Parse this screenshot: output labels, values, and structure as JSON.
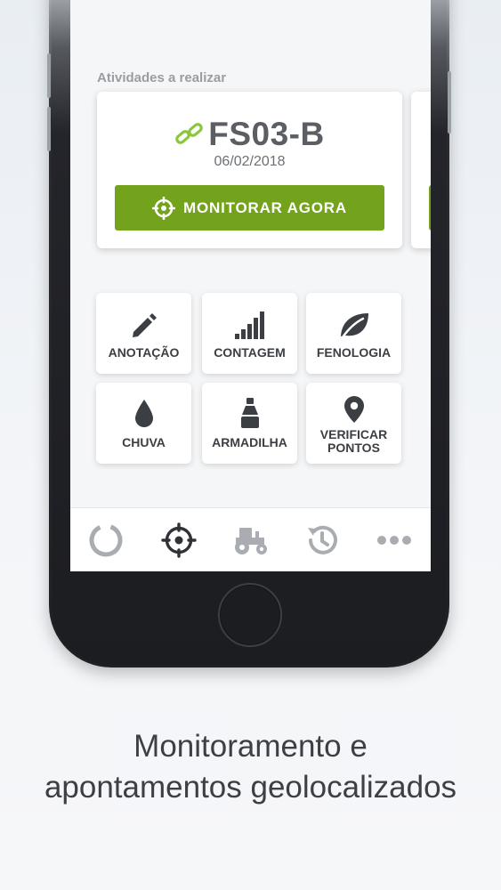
{
  "section": {
    "activities_label": "Atividades a realizar"
  },
  "activity_card": {
    "title": "FS03-B",
    "date": "06/02/2018",
    "button_label": "MONITORAR AGORA",
    "icon": "chain-link-icon"
  },
  "actions": [
    {
      "label": "ANOTAÇÃO",
      "icon": "pencil-icon"
    },
    {
      "label": "CONTAGEM",
      "icon": "bars-icon"
    },
    {
      "label": "FENOLOGIA",
      "icon": "leaf-icon"
    },
    {
      "label": "CHUVA",
      "icon": "drop-icon"
    },
    {
      "label": "ARMADILHA",
      "icon": "trap-icon"
    },
    {
      "label": "VERIFICAR\nPONTOS",
      "icon": "map-pin-icon"
    }
  ],
  "tabbar": {
    "tabs": [
      {
        "icon": "progress-ring-icon",
        "active": false
      },
      {
        "icon": "crosshair-icon",
        "active": true
      },
      {
        "icon": "tractor-icon",
        "active": false
      },
      {
        "icon": "history-icon",
        "active": false
      },
      {
        "icon": "more-icon",
        "active": false
      }
    ]
  },
  "caption": {
    "line1": "Monitoramento e",
    "line2": "apontamentos geolocalizados"
  },
  "colors": {
    "accent_green": "#73a31c",
    "link_green": "#8cc63f",
    "text_dark": "#3b3e42",
    "tab_inactive": "#a9adb2"
  }
}
